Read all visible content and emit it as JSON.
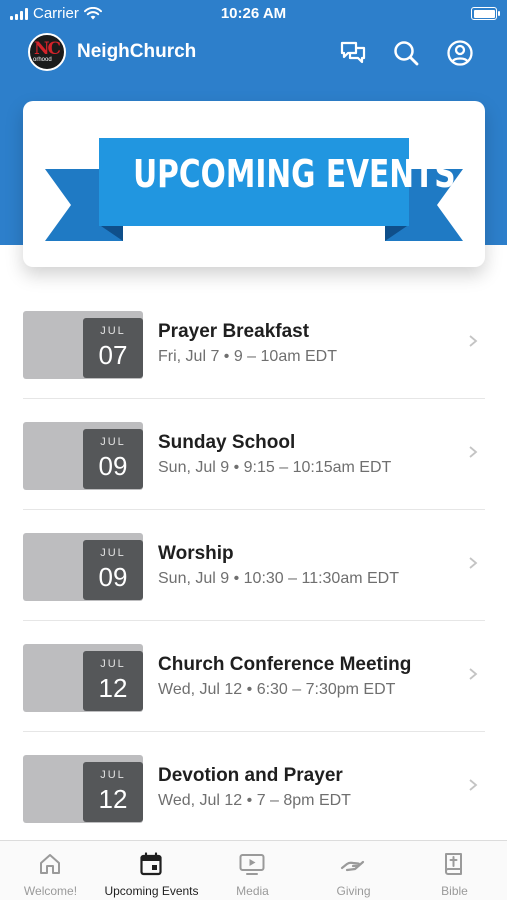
{
  "status_bar": {
    "carrier": "Carrier",
    "time": "10:26 AM"
  },
  "header": {
    "app_title": "NeighChurch",
    "logo_text": "NC",
    "logo_subtext": "orhood"
  },
  "banner": {
    "text": "UPCOMING EVENTS"
  },
  "events": [
    {
      "month": "JUL",
      "day": "07",
      "title": "Prayer Breakfast",
      "subtitle": "Fri, Jul 7 • 9 – 10am EDT"
    },
    {
      "month": "JUL",
      "day": "09",
      "title": "Sunday School",
      "subtitle": "Sun, Jul 9 • 9:15 – 10:15am EDT"
    },
    {
      "month": "JUL",
      "day": "09",
      "title": "Worship",
      "subtitle": "Sun, Jul 9 • 10:30 – 11:30am EDT"
    },
    {
      "month": "JUL",
      "day": "12",
      "title": "Church Conference Meeting",
      "subtitle": "Wed, Jul 12 • 6:30 – 7:30pm EDT"
    },
    {
      "month": "JUL",
      "day": "12",
      "title": "Devotion and Prayer",
      "subtitle": "Wed, Jul 12 • 7 – 8pm EDT"
    }
  ],
  "tabs": [
    {
      "label": "Welcome!",
      "icon": "home-icon",
      "active": false
    },
    {
      "label": "Upcoming Events",
      "icon": "calendar-icon",
      "active": true
    },
    {
      "label": "Media",
      "icon": "play-screen-icon",
      "active": false
    },
    {
      "label": "Giving",
      "icon": "giving-hand-icon",
      "active": false
    },
    {
      "label": "Bible",
      "icon": "bible-icon",
      "active": false
    }
  ],
  "colors": {
    "header_blue": "#2d7fcb",
    "ribbon_blue": "#2196e0",
    "ribbon_dark": "#1565a8",
    "calendar_dark": "#555759",
    "calendar_light": "#bdbdbf"
  }
}
